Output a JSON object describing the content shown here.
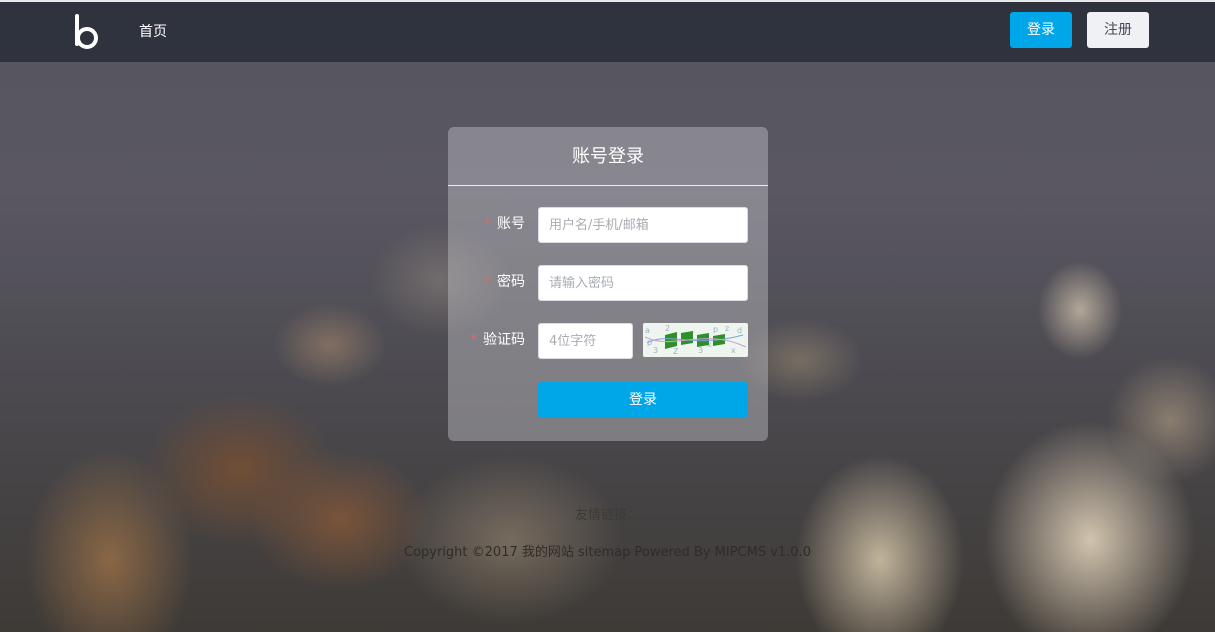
{
  "header": {
    "nav": {
      "home_label": "首页"
    },
    "login_label": "登录",
    "register_label": "注册"
  },
  "login_panel": {
    "title": "账号登录",
    "required_mark": "*",
    "fields": {
      "account": {
        "label": "账号",
        "placeholder": "用户名/手机/邮箱",
        "value": ""
      },
      "password": {
        "label": "密码",
        "placeholder": "请输入密码",
        "value": ""
      },
      "captcha": {
        "label": "验证码",
        "placeholder": "4位字符",
        "value": ""
      }
    },
    "submit_label": "登录"
  },
  "footer": {
    "friend_links_label": "友情链接：",
    "copyright": "Copyright ©2017 我的网站 sitemap Powered By MIPCMS v1.0.0"
  },
  "colors": {
    "header_bg": "#2f333d",
    "accent": "#00a7e8",
    "required": "#ff5a5a"
  },
  "icons": {
    "logo": "b-logo-icon",
    "captcha": "captcha-image"
  }
}
